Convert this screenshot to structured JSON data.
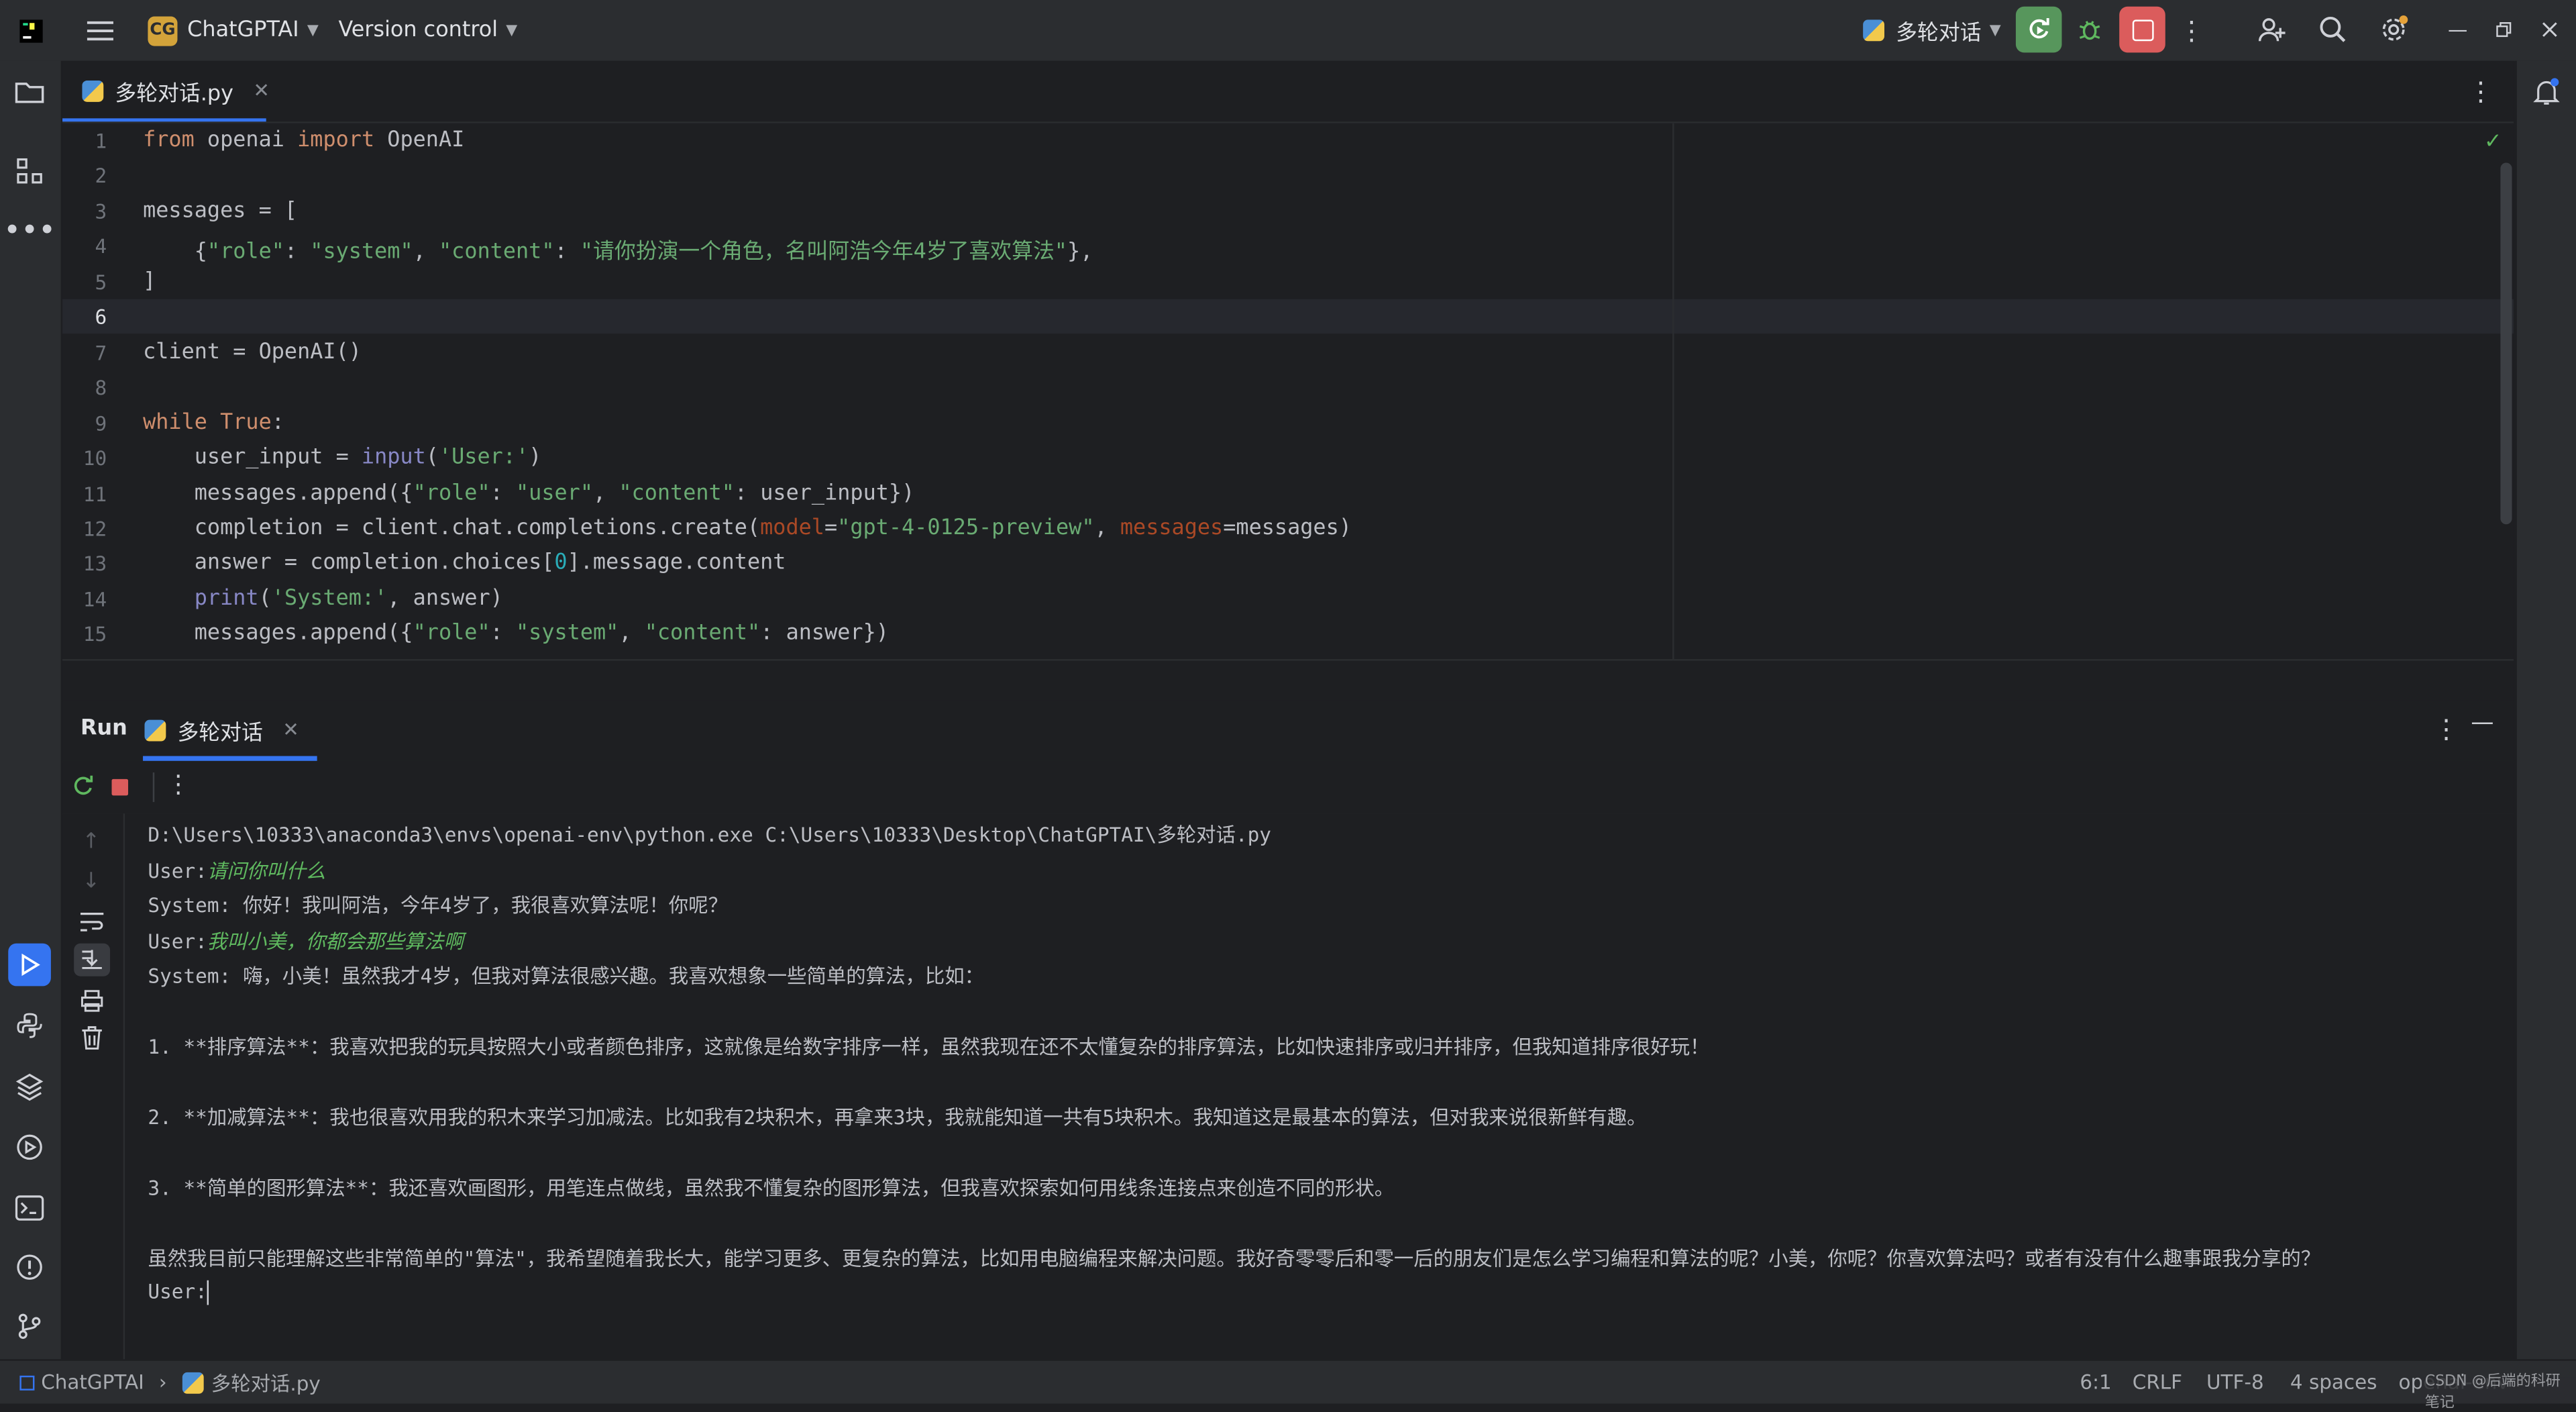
{
  "topbar": {
    "project_badge": "CG",
    "project_name": "ChatGPTAI",
    "vcs": "Version control",
    "run_config": "多轮对话"
  },
  "editor": {
    "tab_name": "多轮对话.py",
    "line_numbers": [
      "1",
      "2",
      "3",
      "4",
      "5",
      "6",
      "7",
      "8",
      "9",
      "10",
      "11",
      "12",
      "13",
      "14",
      "15"
    ],
    "code_lines": [
      {
        "t": [
          {
            "c": "kw",
            "v": "from"
          },
          {
            "c": "",
            "v": " openai "
          },
          {
            "c": "kw",
            "v": "import"
          },
          {
            "c": "",
            "v": " OpenAI"
          }
        ]
      },
      {
        "t": []
      },
      {
        "t": [
          {
            "c": "",
            "v": "messages = ["
          }
        ]
      },
      {
        "t": [
          {
            "c": "",
            "v": "    {"
          },
          {
            "c": "str",
            "v": "\"role\""
          },
          {
            "c": "",
            "v": ": "
          },
          {
            "c": "str",
            "v": "\"system\""
          },
          {
            "c": "",
            "v": ", "
          },
          {
            "c": "str",
            "v": "\"content\""
          },
          {
            "c": "",
            "v": ": "
          },
          {
            "c": "str",
            "v": "\"请你扮演一个角色，名叫阿浩今年4岁了喜欢算法\""
          },
          {
            "c": "",
            "v": "},"
          }
        ]
      },
      {
        "t": [
          {
            "c": "",
            "v": "]"
          }
        ]
      },
      {
        "t": []
      },
      {
        "t": [
          {
            "c": "",
            "v": "client = OpenAI()"
          }
        ]
      },
      {
        "t": []
      },
      {
        "t": [
          {
            "c": "kw",
            "v": "while"
          },
          {
            "c": "",
            "v": " "
          },
          {
            "c": "kw",
            "v": "True"
          },
          {
            "c": "",
            "v": ":"
          }
        ]
      },
      {
        "t": [
          {
            "c": "",
            "v": "    user_input = "
          },
          {
            "c": "builtin",
            "v": "input"
          },
          {
            "c": "",
            "v": "("
          },
          {
            "c": "str",
            "v": "'User:'"
          },
          {
            "c": "",
            "v": ")"
          }
        ]
      },
      {
        "t": [
          {
            "c": "",
            "v": "    messages.append({"
          },
          {
            "c": "str",
            "v": "\"role\""
          },
          {
            "c": "",
            "v": ": "
          },
          {
            "c": "str",
            "v": "\"user\""
          },
          {
            "c": "",
            "v": ", "
          },
          {
            "c": "str",
            "v": "\"content\""
          },
          {
            "c": "",
            "v": ": user_input})"
          }
        ]
      },
      {
        "t": [
          {
            "c": "",
            "v": "    completion = client.chat.completions.create("
          },
          {
            "c": "param",
            "v": "model"
          },
          {
            "c": "",
            "v": "="
          },
          {
            "c": "str",
            "v": "\"gpt-4-0125-preview\""
          },
          {
            "c": "",
            "v": ", "
          },
          {
            "c": "param",
            "v": "messages"
          },
          {
            "c": "",
            "v": "=messages)"
          }
        ]
      },
      {
        "t": [
          {
            "c": "",
            "v": "    answer = completion.choices["
          },
          {
            "c": "num",
            "v": "0"
          },
          {
            "c": "",
            "v": "].message.content"
          }
        ]
      },
      {
        "t": [
          {
            "c": "",
            "v": "    "
          },
          {
            "c": "builtin",
            "v": "print"
          },
          {
            "c": "",
            "v": "("
          },
          {
            "c": "str",
            "v": "'System:'"
          },
          {
            "c": "",
            "v": ", answer)"
          }
        ]
      },
      {
        "t": [
          {
            "c": "",
            "v": "    messages.append({"
          },
          {
            "c": "str",
            "v": "\"role\""
          },
          {
            "c": "",
            "v": ": "
          },
          {
            "c": "str",
            "v": "\"system\""
          },
          {
            "c": "",
            "v": ", "
          },
          {
            "c": "str",
            "v": "\"content\""
          },
          {
            "c": "",
            "v": ": answer})"
          }
        ]
      }
    ]
  },
  "run": {
    "title": "Run",
    "tab_name": "多轮对话",
    "console_lines": [
      {
        "t": [
          {
            "c": "",
            "v": "D:\\Users\\10333\\anaconda3\\envs\\openai-env\\python.exe C:\\Users\\10333\\Desktop\\ChatGPTAI\\多轮对话.py"
          }
        ]
      },
      {
        "t": [
          {
            "c": "",
            "v": "User:"
          },
          {
            "c": "userin",
            "v": "请问你叫什么"
          }
        ]
      },
      {
        "t": [
          {
            "c": "",
            "v": "System: 你好！我叫阿浩，今年4岁了，我很喜欢算法呢！你呢？"
          }
        ]
      },
      {
        "t": [
          {
            "c": "",
            "v": "User:"
          },
          {
            "c": "userin",
            "v": "我叫小美，你都会那些算法啊"
          }
        ]
      },
      {
        "t": [
          {
            "c": "",
            "v": "System: 嗨，小美！虽然我才4岁，但我对算法很感兴趣。我喜欢想象一些简单的算法，比如："
          }
        ]
      },
      {
        "t": []
      },
      {
        "t": [
          {
            "c": "",
            "v": "1. **排序算法**：我喜欢把我的玩具按照大小或者颜色排序，这就像是给数字排序一样，虽然我现在还不太懂复杂的排序算法，比如快速排序或归并排序，但我知道排序很好玩！"
          }
        ]
      },
      {
        "t": []
      },
      {
        "t": [
          {
            "c": "",
            "v": "2. **加减算法**：我也很喜欢用我的积木来学习加减法。比如我有2块积木，再拿来3块，我就能知道一共有5块积木。我知道这是最基本的算法，但对我来说很新鲜有趣。"
          }
        ]
      },
      {
        "t": []
      },
      {
        "t": [
          {
            "c": "",
            "v": "3. **简单的图形算法**：我还喜欢画图形，用笔连点做线，虽然我不懂复杂的图形算法，但我喜欢探索如何用线条连接点来创造不同的形状。"
          }
        ]
      },
      {
        "t": []
      },
      {
        "t": [
          {
            "c": "",
            "v": "虽然我目前只能理解这些非常简单的\"算法\"，我希望随着我长大，能学习更多、更复杂的算法，比如用电脑编程来解决问题。我好奇零零后和零一后的朋友们是怎么学习编程和算法的呢？小美，你呢？你喜欢算法吗？或者有没有什么趣事跟我分享的？"
          }
        ]
      },
      {
        "t": [
          {
            "c": "",
            "v": "User:"
          },
          {
            "c": "cursor",
            "v": ""
          }
        ]
      }
    ]
  },
  "statusbar": {
    "project": "ChatGPTAI",
    "file": "多轮对话.py",
    "position": "6:1",
    "line_sep": "CRLF",
    "encoding": "UTF-8",
    "indent": "4 spaces",
    "interpreter": "openai-env",
    "watermark": "CSDN @后端的科研笔记"
  },
  "colors": {
    "accent": "#3574f0",
    "run_green": "#57965c",
    "stop_red": "#db5c5c"
  }
}
